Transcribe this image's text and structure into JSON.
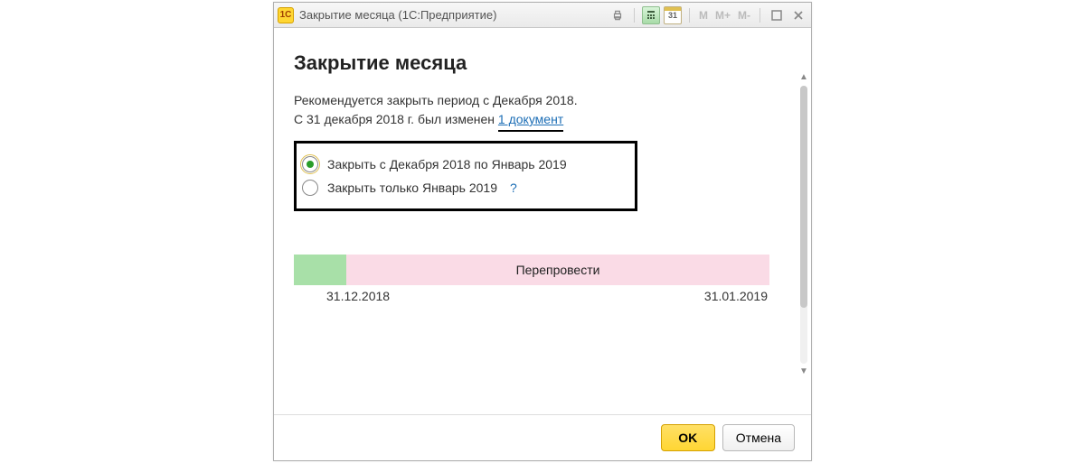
{
  "titlebar": {
    "app_short": "1C",
    "title": "Закрытие месяца  (1С:Предприятие)",
    "mem_m": "M",
    "mem_mplus": "M+",
    "mem_mminus": "M-",
    "calendar_day": "31"
  },
  "header": {
    "title": "Закрытие месяца"
  },
  "recommend": {
    "line1": "Рекомендуется закрыть период с Декабря 2018.",
    "line2_prefix": "С 31 декабря 2018 г. был изменен ",
    "link_text": "1 документ"
  },
  "options": {
    "opt1": "Закрыть с Декабря 2018 по Январь 2019",
    "opt2": "Закрыть только Январь 2019",
    "help": "?"
  },
  "progress": {
    "action_label": "Перепровести",
    "date_start": "31.12.2018",
    "date_end": "31.01.2019"
  },
  "footer": {
    "ok": "OK",
    "cancel": "Отмена"
  }
}
